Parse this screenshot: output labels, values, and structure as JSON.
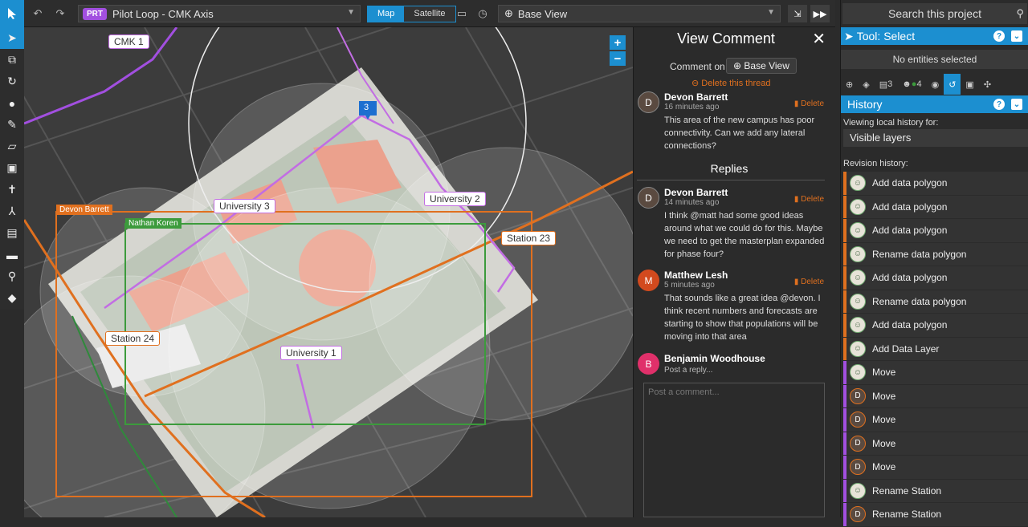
{
  "toolbar": {
    "project_badge": "PRT",
    "project_name": "Pilot Loop - CMK Axis",
    "map_label": "Map",
    "satellite_label": "Satellite",
    "base_view": "Base View"
  },
  "map": {
    "labels": {
      "cmk1": "CMK 1",
      "marker_count": "3",
      "university2": "University 2",
      "university3": "University 3",
      "university1": "University 1",
      "station23": "Station 23",
      "station24": "Station 24",
      "devon_tag": "Devon Barrett",
      "nathan_tag": "Nathan Koren"
    },
    "zoom_in": "+",
    "zoom_out": "−"
  },
  "comment": {
    "title": "View Comment",
    "comment_on": "Comment on",
    "base_view_btn": "Base View",
    "delete_thread": "Delete this thread",
    "replies_title": "Replies",
    "delete_label": "Delete",
    "main": {
      "initial": "D",
      "name": "Devon Barrett",
      "time": "16 minutes ago",
      "text": "This area of the new campus has poor connectivity. Can we add any lateral connections?"
    },
    "replies": [
      {
        "initial": "D",
        "name": "Devon Barrett",
        "time": "14 minutes ago",
        "text": "I think @matt had some good ideas around what we could do for this. Maybe we need to get the masterplan expanded for phase four?"
      },
      {
        "initial": "M",
        "name": "Matthew Lesh",
        "time": "5 minutes ago",
        "text": "That sounds like a great idea @devon. I think recent numbers and forecasts are starting to show that populations will be moving into that area"
      }
    ],
    "reply_user": {
      "initial": "B",
      "name": "Benjamin Woodhouse",
      "prompt": "Post a reply..."
    },
    "post_placeholder": "Post a comment..."
  },
  "right": {
    "search_placeholder": "Search this project",
    "tool_title": "Tool: Select",
    "no_entities": "No entities selected",
    "tab_comments_count": "3",
    "tab_users_count": "4",
    "history_title": "History",
    "viewing_label": "Viewing local history for:",
    "visible_layers": "Visible layers",
    "revision_label": "Revision history:",
    "revisions": [
      {
        "label": "Add data polygon",
        "color": "#e0701f",
        "type": "photo"
      },
      {
        "label": "Add data polygon",
        "color": "#e0701f",
        "type": "photo"
      },
      {
        "label": "Add data polygon",
        "color": "#e0701f",
        "type": "photo"
      },
      {
        "label": "Rename data polygon",
        "color": "#e0701f",
        "type": "photo"
      },
      {
        "label": "Add data polygon",
        "color": "#e0701f",
        "type": "photo"
      },
      {
        "label": "Rename data polygon",
        "color": "#e0701f",
        "type": "photo"
      },
      {
        "label": "Add data polygon",
        "color": "#e0701f",
        "type": "photo"
      },
      {
        "label": "Add Data Layer",
        "color": "#e0701f",
        "type": "photo"
      },
      {
        "label": "Move",
        "color": "#a24fe0",
        "type": "photo"
      },
      {
        "label": "Move",
        "color": "#a24fe0",
        "type": "D"
      },
      {
        "label": "Move",
        "color": "#a24fe0",
        "type": "D"
      },
      {
        "label": "Move",
        "color": "#a24fe0",
        "type": "D"
      },
      {
        "label": "Move",
        "color": "#a24fe0",
        "type": "D"
      },
      {
        "label": "Rename Station",
        "color": "#a24fe0",
        "type": "photo"
      },
      {
        "label": "Rename Station",
        "color": "#a24fe0",
        "type": "D"
      }
    ]
  },
  "colors": {
    "accent": "#1c8fd0",
    "orange": "#e0701f",
    "purple": "#a24fe0",
    "green": "#3c9b3c"
  }
}
